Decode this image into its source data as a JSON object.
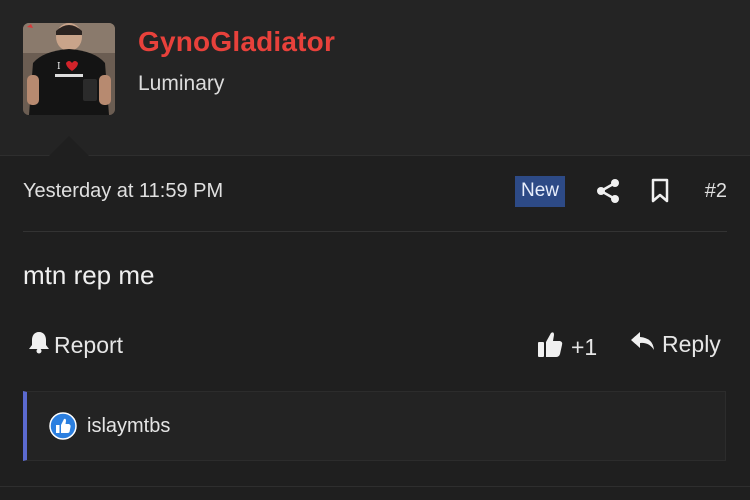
{
  "author": {
    "username": "GynoGladiator",
    "user_title": "Luminary",
    "avatar_icon": "user-avatar-photo",
    "username_color": "#e8413b"
  },
  "post": {
    "timestamp": "Yesterday at 11:59 PM",
    "new_badge": "New",
    "post_number": "#2",
    "message": "mtn rep me"
  },
  "actions": {
    "report_label": "Report",
    "like_count": "+1",
    "reply_label": "Reply"
  },
  "reactions": {
    "user": "islaymtbs",
    "icon": "thumbs-up-reaction-icon"
  },
  "colors": {
    "accent_border": "#5b6ad0",
    "new_badge_bg": "#2d4a86"
  }
}
